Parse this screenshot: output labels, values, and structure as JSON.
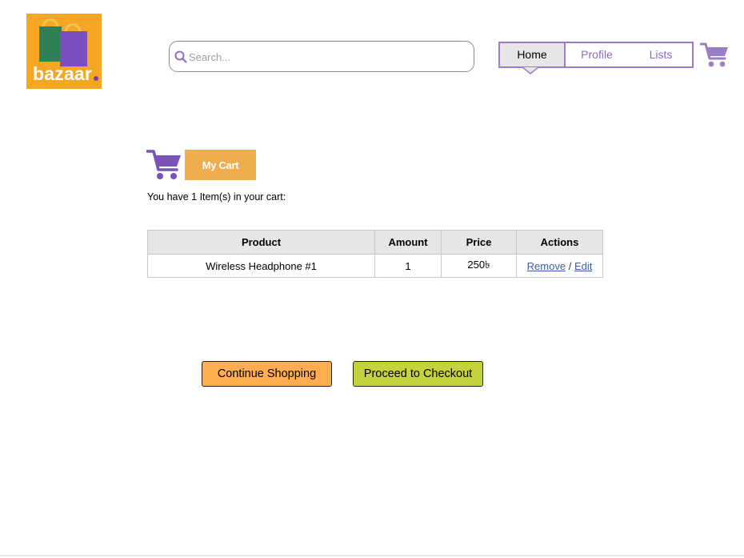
{
  "brand": {
    "name": "bazaar",
    "accent": "#f5a623",
    "dot_color": "#7b3fa0"
  },
  "search": {
    "placeholder": "Search..."
  },
  "nav": {
    "items": [
      {
        "label": "Home",
        "active": true
      },
      {
        "label": "Profile",
        "active": false
      },
      {
        "label": "Lists",
        "active": false
      }
    ],
    "border_color": "#9b7cc7"
  },
  "icons": {
    "search": "search-icon",
    "cart": "shopping-cart-icon"
  },
  "cart": {
    "button_label": "My Cart",
    "summary": "You have 1 Item(s) in your cart:",
    "columns": [
      "Product",
      "Amount",
      "Price",
      "Actions"
    ],
    "rows": [
      {
        "product": "Wireless Headphone #1",
        "amount": "1",
        "price": "250৳",
        "remove_label": "Remove",
        "separator": "/",
        "edit_label": "Edit"
      }
    ]
  },
  "buttons": {
    "continue_label": "Continue Shopping",
    "checkout_label": "Proceed to Checkout"
  },
  "colors": {
    "cart_purple": "#7b52b8",
    "continue_bg": "#ffad4f",
    "checkout_bg": "#c4d23b",
    "my_cart_bg": "#f0ad4e"
  }
}
